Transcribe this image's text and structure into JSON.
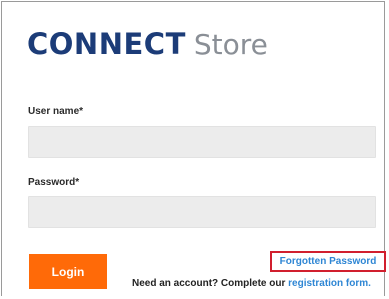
{
  "logo": {
    "brand": "CONNECT",
    "store": "Store"
  },
  "form": {
    "username_label": "User name*",
    "username_value": "",
    "password_label": "Password*",
    "password_value": ""
  },
  "actions": {
    "login_label": "Login",
    "forgot_password_label": "Forgotten Password",
    "register_prompt": "Need an account? Complete our ",
    "register_link": "registration form."
  },
  "colors": {
    "brand_navy": "#1c3c78",
    "store_gray": "#8a8f96",
    "login_orange": "#ff6a08",
    "link_blue": "#2e86d4",
    "highlight_red": "#d11f2e"
  }
}
